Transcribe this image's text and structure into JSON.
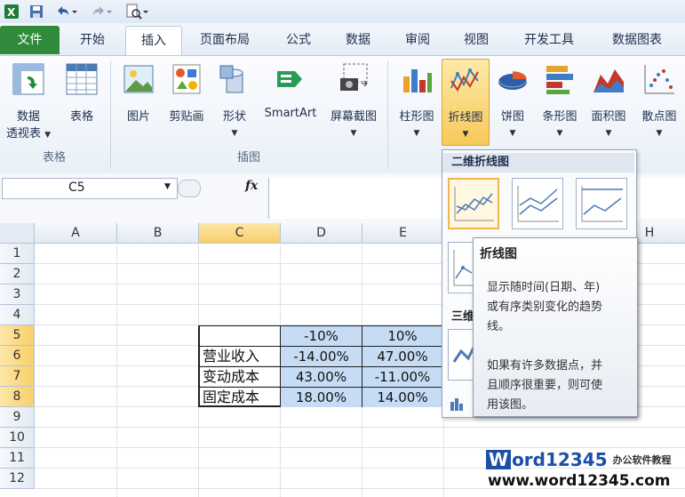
{
  "quick_access": {
    "app_icon": "excel-icon",
    "save_icon": "save-icon",
    "undo_icon": "undo-icon",
    "redo_icon": "redo-icon",
    "preview_icon": "print-preview-icon"
  },
  "tabs": [
    {
      "label": "文件"
    },
    {
      "label": "开始"
    },
    {
      "label": "插入"
    },
    {
      "label": "页面布局"
    },
    {
      "label": "公式"
    },
    {
      "label": "数据"
    },
    {
      "label": "审阅"
    },
    {
      "label": "视图"
    },
    {
      "label": "开发工具"
    },
    {
      "label": "数据图表"
    }
  ],
  "ribbon": {
    "pivot_line1": "数据",
    "pivot_line2": "透视表",
    "table": "表格",
    "picture": "图片",
    "clipart": "剪贴画",
    "shapes": "形状",
    "smartart": "SmartArt",
    "screenshot": "屏幕截图",
    "column": "柱形图",
    "line": "折线图",
    "pie": "饼图",
    "bar": "条形图",
    "area": "面积图",
    "scatter": "散点图",
    "group_tables": "表格",
    "group_illustrations": "插图"
  },
  "formula_bar": {
    "name_box": "C5",
    "fx": "fx"
  },
  "columns": [
    "A",
    "B",
    "C",
    "D",
    "E",
    "H"
  ],
  "rows": [
    "1",
    "2",
    "3",
    "4",
    "5",
    "6",
    "7",
    "8",
    "9",
    "10",
    "11",
    "12"
  ],
  "table": {
    "header": [
      "",
      "-10%",
      "10%"
    ],
    "rows": [
      {
        "label": "营业收入",
        "d": "-14.00%",
        "e": "47.00%"
      },
      {
        "label": "变动成本",
        "d": "43.00%",
        "e": "-11.00%"
      },
      {
        "label": "固定成本",
        "d": "18.00%",
        "e": "14.00%"
      }
    ]
  },
  "dropdown": {
    "section_2d": "二维折线图",
    "section_3d_partial": "三维"
  },
  "tooltip": {
    "title": "折线图",
    "line1": "显示随时间(日期、年)",
    "line2": "或有序类别变化的趋势",
    "line3": "线。",
    "line4": "如果有许多数据点，并",
    "line5": "且顺序很重要，则可使",
    "line6": "用该图。"
  },
  "watermark": {
    "brand_w": "W",
    "brand_rest": "ord12345",
    "tag": "办公软件教程",
    "url": "www.word12345.com"
  },
  "colors": {
    "file_tab": "#2f8a3b",
    "selection_blue": "#c5dcf4",
    "highlight_orange": "#f8cf6a"
  }
}
